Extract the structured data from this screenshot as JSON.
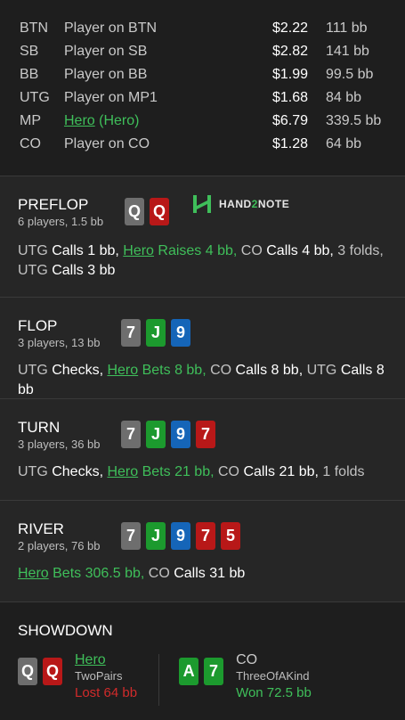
{
  "players": [
    {
      "pos": "BTN",
      "name": "Player on BTN",
      "hero_tag": "",
      "money": "$2.22",
      "bb": "111 bb",
      "is_hero": false
    },
    {
      "pos": "SB",
      "name": "Player on SB",
      "hero_tag": "",
      "money": "$2.82",
      "bb": "141 bb",
      "is_hero": false
    },
    {
      "pos": "BB",
      "name": "Player on BB",
      "hero_tag": "",
      "money": "$1.99",
      "bb": "99.5 bb",
      "is_hero": false
    },
    {
      "pos": "UTG",
      "name": "Player on MP1",
      "hero_tag": "",
      "money": "$1.68",
      "bb": "84 bb",
      "is_hero": false
    },
    {
      "pos": "MP",
      "name": "Hero",
      "hero_tag": " (Hero)",
      "money": "$6.79",
      "bb": "339.5 bb",
      "is_hero": true
    },
    {
      "pos": "CO",
      "name": "Player on CO",
      "hero_tag": "",
      "money": "$1.28",
      "bb": "64 bb",
      "is_hero": false
    }
  ],
  "logo": {
    "part1": "HAND",
    "part2": "2",
    "part3": "NOTE",
    "color": "#3fbf5a"
  },
  "streets": {
    "preflop": {
      "title": "PREFLOP",
      "subtitle": "6 players, 1.5 bb",
      "cards": [
        {
          "rank": "Q",
          "color": "grey"
        },
        {
          "rank": "Q",
          "color": "red"
        }
      ],
      "actions": [
        {
          "text": "UTG ",
          "style": "n"
        },
        {
          "text": "Calls 1 bb, ",
          "style": "w"
        },
        {
          "text": "Hero",
          "style": "hl"
        },
        {
          "text": " Raises 4 bb, ",
          "style": "g"
        },
        {
          "text": "CO ",
          "style": "n"
        },
        {
          "text": "Calls 4 bb, ",
          "style": "w"
        },
        {
          "text": "3 folds, ",
          "style": "n"
        },
        {
          "text": "UTG ",
          "style": "n"
        },
        {
          "text": "Calls 3 bb",
          "style": "w"
        }
      ]
    },
    "flop": {
      "title": "FLOP",
      "subtitle": "3 players, 13 bb",
      "cards": [
        {
          "rank": "7",
          "color": "grey"
        },
        {
          "rank": "J",
          "color": "green"
        },
        {
          "rank": "9",
          "color": "blue"
        }
      ],
      "actions": [
        {
          "text": "UTG ",
          "style": "n"
        },
        {
          "text": "Checks, ",
          "style": "w"
        },
        {
          "text": "Hero",
          "style": "hl"
        },
        {
          "text": " Bets 8 bb, ",
          "style": "g"
        },
        {
          "text": "CO ",
          "style": "n"
        },
        {
          "text": "Calls 8 bb, ",
          "style": "w"
        },
        {
          "text": "UTG ",
          "style": "n"
        },
        {
          "text": "Calls 8 bb",
          "style": "w"
        }
      ]
    },
    "turn": {
      "title": "TURN",
      "subtitle": "3 players, 36 bb",
      "cards": [
        {
          "rank": "7",
          "color": "grey"
        },
        {
          "rank": "J",
          "color": "green"
        },
        {
          "rank": "9",
          "color": "blue"
        },
        {
          "rank": "7",
          "color": "red"
        }
      ],
      "actions": [
        {
          "text": "UTG ",
          "style": "n"
        },
        {
          "text": "Checks, ",
          "style": "w"
        },
        {
          "text": "Hero",
          "style": "hl"
        },
        {
          "text": " Bets 21 bb, ",
          "style": "g"
        },
        {
          "text": "CO ",
          "style": "n"
        },
        {
          "text": "Calls 21 bb, ",
          "style": "w"
        },
        {
          "text": "1 folds",
          "style": "n"
        }
      ]
    },
    "river": {
      "title": "RIVER",
      "subtitle": "2 players, 76 bb",
      "cards": [
        {
          "rank": "7",
          "color": "grey"
        },
        {
          "rank": "J",
          "color": "green"
        },
        {
          "rank": "9",
          "color": "blue"
        },
        {
          "rank": "7",
          "color": "red"
        },
        {
          "rank": "5",
          "color": "red"
        }
      ],
      "actions": [
        {
          "text": "Hero",
          "style": "hl"
        },
        {
          "text": " Bets 306.5 bb, ",
          "style": "g"
        },
        {
          "text": "CO ",
          "style": "n"
        },
        {
          "text": "Calls 31 bb",
          "style": "w"
        }
      ]
    }
  },
  "showdown": {
    "title": "SHOWDOWN",
    "players": [
      {
        "name": "Hero",
        "hand": "TwoPairs",
        "result": "Lost 64 bb",
        "name_color": "#3fbf5a",
        "result_color": "#d12b2b",
        "cards": [
          {
            "rank": "Q",
            "color": "grey"
          },
          {
            "rank": "Q",
            "color": "red"
          }
        ]
      },
      {
        "name": "CO",
        "hand": "ThreeOfAKind",
        "result": "Won 72.5 bb",
        "name_color": "#c9c9c9",
        "result_color": "#3fbf5a",
        "cards": [
          {
            "rank": "A",
            "color": "green"
          },
          {
            "rank": "7",
            "color": "green"
          }
        ]
      }
    ]
  }
}
